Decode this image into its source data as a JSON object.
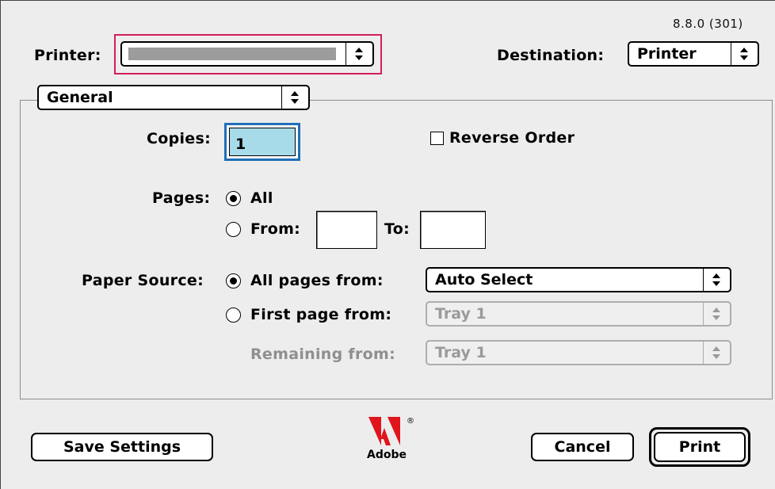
{
  "version": "8.8.0 (301)",
  "printer": {
    "label": "Printer:",
    "selected": ""
  },
  "destination": {
    "label": "Destination:",
    "selected": "Printer"
  },
  "panel_menu": {
    "selected": "General"
  },
  "copies": {
    "label": "Copies:",
    "value": "1"
  },
  "reverse_order": {
    "label": "Reverse Order",
    "checked": false
  },
  "pages": {
    "label": "Pages:",
    "all_label": "All",
    "from_label": "From:",
    "to_label": "To:",
    "from_value": "",
    "to_value": "",
    "selected": "All"
  },
  "paper_source": {
    "label": "Paper Source:",
    "all_pages_label": "All pages from:",
    "all_pages_value": "Auto Select",
    "first_page_label": "First page from:",
    "first_page_value": "Tray 1",
    "remaining_label": "Remaining from:",
    "remaining_value": "Tray 1",
    "selected": "All pages from:"
  },
  "buttons": {
    "save": "Save Settings",
    "cancel": "Cancel",
    "print": "Print"
  },
  "logo": {
    "text": "Adobe",
    "registered": "®"
  },
  "colors": {
    "highlight": "#d21d5e",
    "focus_ring": "#1f6fb7",
    "field_fill": "#a8dbe9",
    "dialog_bg": "#ededed"
  },
  "icons": {
    "popup_arrow": "up-down-arrows-icon",
    "logo": "adobe-logo-icon"
  }
}
